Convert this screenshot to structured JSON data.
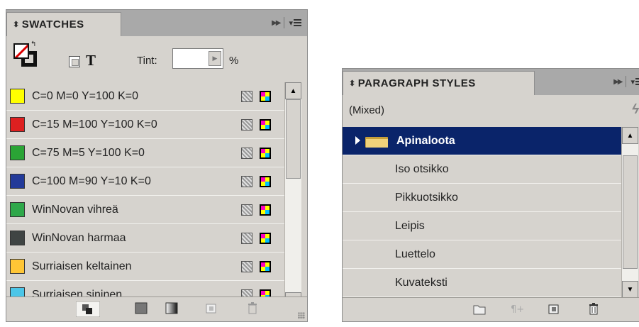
{
  "swatches_panel": {
    "title": "SWATCHES",
    "tint_label": "Tint:",
    "tint_value": "",
    "tint_unit": "%",
    "format_text_icon_label": "T",
    "items": [
      {
        "label": "C=0 M=0 Y=100 K=0",
        "color": "#ffff00"
      },
      {
        "label": "C=15 M=100 Y=100 K=0",
        "color": "#dd2020"
      },
      {
        "label": "C=75 M=5 Y=100 K=0",
        "color": "#2aa435"
      },
      {
        "label": "C=100 M=90 Y=10 K=0",
        "color": "#233a99"
      },
      {
        "label": "WinNovan vihreä",
        "color": "#2fa84a"
      },
      {
        "label": "WinNovan harmaa",
        "color": "#3f4443"
      },
      {
        "label": "Surriaisen keltainen",
        "color": "#ffc636"
      },
      {
        "label": "Surriaisen sininen",
        "color": "#4cc6e8"
      }
    ]
  },
  "paragraph_styles_panel": {
    "title": "PARAGRAPH STYLES",
    "current_style": "(Mixed)",
    "group": {
      "label": "Apinaloota",
      "expanded": false
    },
    "items": [
      {
        "label": "Iso otsikko"
      },
      {
        "label": "Pikkuotsikko"
      },
      {
        "label": "Leipis"
      },
      {
        "label": "Luettelo"
      },
      {
        "label": "Kuvateksti"
      }
    ]
  },
  "colors": {
    "panel_bg": "#d6d3ce",
    "tab_strip": "#a9a9a9",
    "selection": "#0a246a"
  },
  "icons": [
    "fill-stroke-icon",
    "format-text-icon",
    "process-color-icon",
    "cmyk-icon",
    "new-color-group-icon",
    "show-all-swatches-icon",
    "show-gradient-swatches-icon",
    "new-swatch-icon",
    "trash-icon",
    "folder-icon",
    "new-style-icon",
    "clear-overrides-icon",
    "lightning-icon",
    "panel-menu-icon",
    "collapse-icon"
  ]
}
